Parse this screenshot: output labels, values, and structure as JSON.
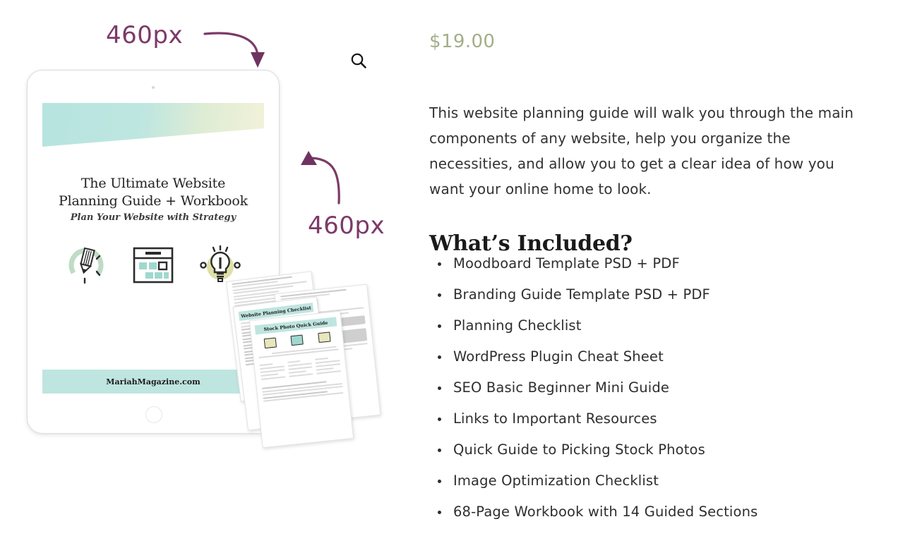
{
  "annotations": {
    "top_label": "460px",
    "side_label": "460px",
    "top_arrow_icon": "curved-arrow-down-icon",
    "side_arrow_icon": "curved-arrow-up-left-icon",
    "color": "#7c3a68"
  },
  "gallery": {
    "zoom_icon": "search-magnifier-icon",
    "cover": {
      "title_line1": "The Ultimate Website",
      "title_line2": "Planning Guide + Workbook",
      "subtitle": "Plan Your Website with Strategy",
      "footer": "MariahMagazine.com",
      "band_color": "#bfe5e0",
      "accent_cream": "#f3f2da",
      "icons": [
        "pencil-circle-icon",
        "browser-window-icon",
        "lightbulb-idea-icon"
      ]
    },
    "papers": [
      {
        "title": "Website Planning Checklist"
      },
      {
        "title": "Stock Photo Quick Guide"
      }
    ]
  },
  "product": {
    "price": "$19.00",
    "price_color": "#a4ae88",
    "description": "This website planning guide will walk you through the main components of any website, help you organize the necessities, and allow you to get a clear idea of how you want your online home to look.",
    "included_heading": "What’s Included?",
    "included_items": [
      "Moodboard Template PSD + PDF",
      "Branding Guide Template PSD + PDF",
      "Planning Checklist",
      "WordPress Plugin Cheat Sheet",
      "SEO Basic Beginner Mini Guide",
      "Links to Important Resources",
      "Quick Guide to Picking Stock Photos",
      "Image Optimization Checklist",
      "68-Page Workbook with 14 Guided Sections"
    ]
  }
}
